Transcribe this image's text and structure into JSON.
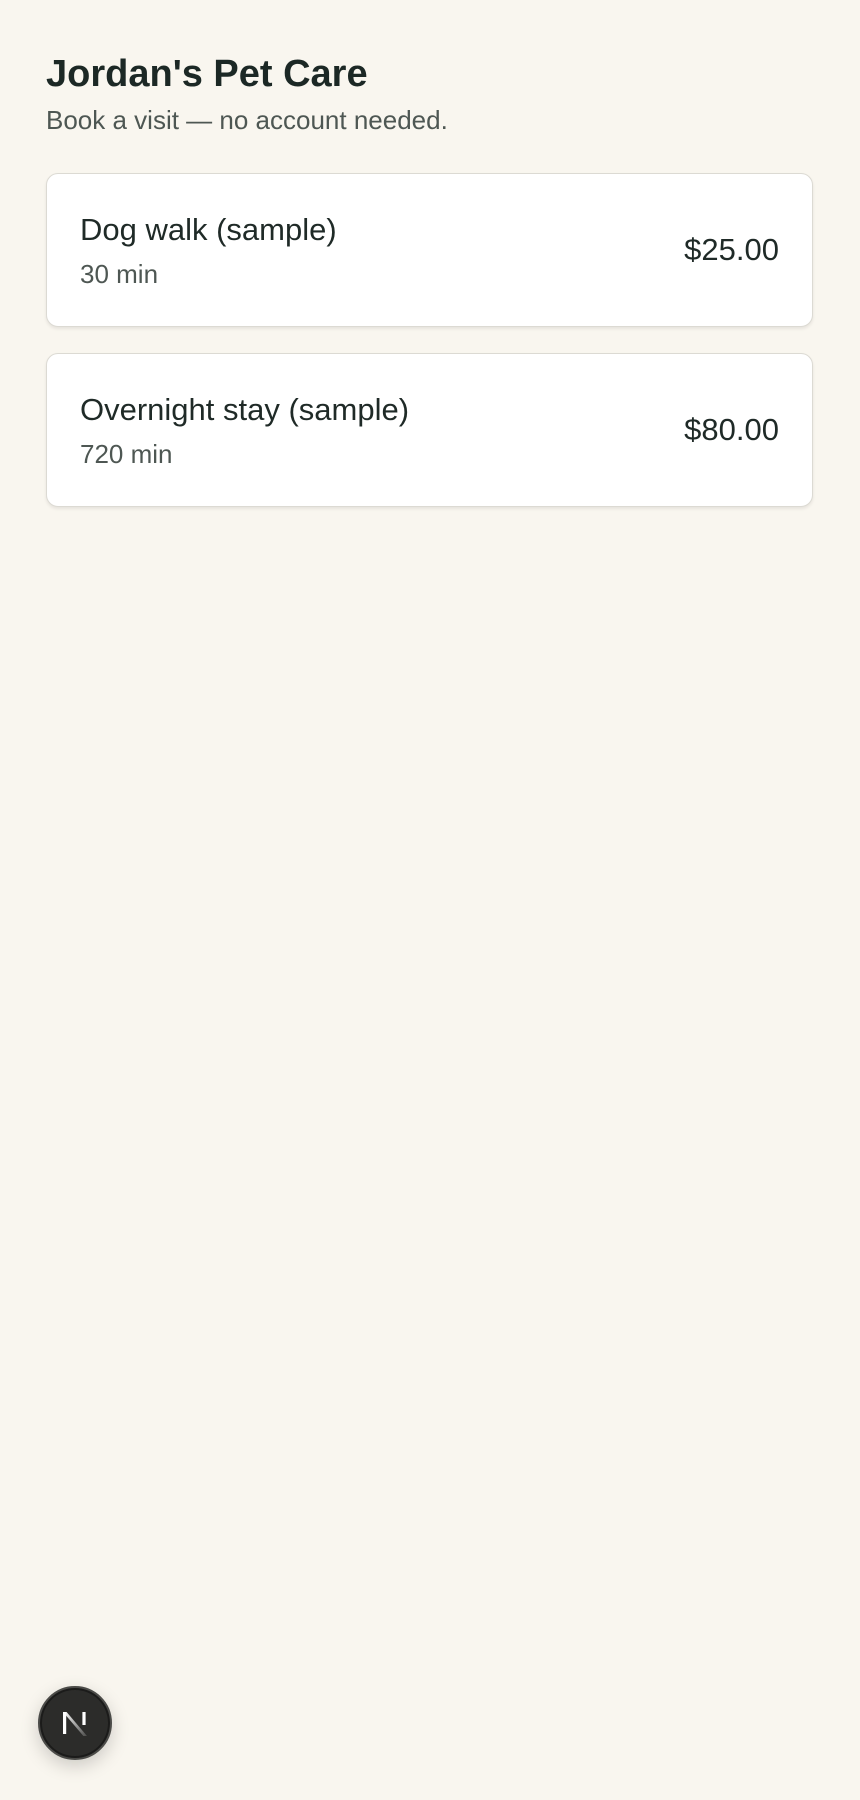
{
  "header": {
    "title": "Jordan's Pet Care",
    "subtitle": "Book a visit — no account needed."
  },
  "services": [
    {
      "name": "Dog walk (sample)",
      "duration": "30 min",
      "price": "$25.00"
    },
    {
      "name": "Overnight stay (sample)",
      "duration": "720 min",
      "price": "$80.00"
    }
  ],
  "badge": {
    "icon": "nextjs-logo-icon"
  },
  "colors": {
    "background": "#f9f6ef",
    "card": "#ffffff",
    "text": "#1f2a27",
    "muted": "#4e5753",
    "badge": "#2c2c2a"
  }
}
